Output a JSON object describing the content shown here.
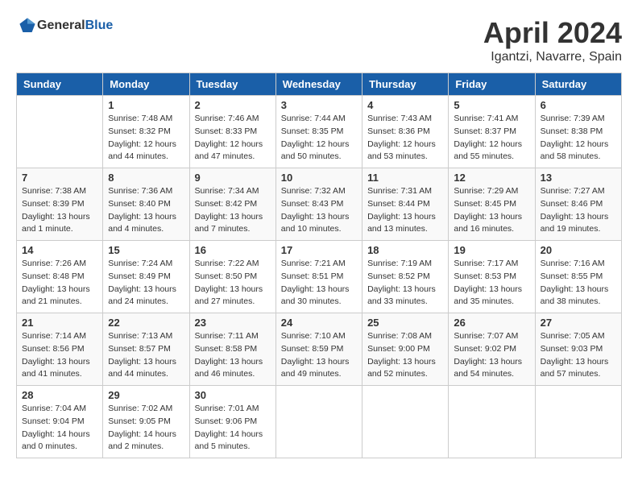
{
  "header": {
    "logo_general": "General",
    "logo_blue": "Blue",
    "month_year": "April 2024",
    "location": "Igantzi, Navarre, Spain"
  },
  "weekdays": [
    "Sunday",
    "Monday",
    "Tuesday",
    "Wednesday",
    "Thursday",
    "Friday",
    "Saturday"
  ],
  "weeks": [
    [
      {
        "day": "",
        "sunrise": "",
        "sunset": "",
        "daylight": ""
      },
      {
        "day": "1",
        "sunrise": "Sunrise: 7:48 AM",
        "sunset": "Sunset: 8:32 PM",
        "daylight": "Daylight: 12 hours and 44 minutes."
      },
      {
        "day": "2",
        "sunrise": "Sunrise: 7:46 AM",
        "sunset": "Sunset: 8:33 PM",
        "daylight": "Daylight: 12 hours and 47 minutes."
      },
      {
        "day": "3",
        "sunrise": "Sunrise: 7:44 AM",
        "sunset": "Sunset: 8:35 PM",
        "daylight": "Daylight: 12 hours and 50 minutes."
      },
      {
        "day": "4",
        "sunrise": "Sunrise: 7:43 AM",
        "sunset": "Sunset: 8:36 PM",
        "daylight": "Daylight: 12 hours and 53 minutes."
      },
      {
        "day": "5",
        "sunrise": "Sunrise: 7:41 AM",
        "sunset": "Sunset: 8:37 PM",
        "daylight": "Daylight: 12 hours and 55 minutes."
      },
      {
        "day": "6",
        "sunrise": "Sunrise: 7:39 AM",
        "sunset": "Sunset: 8:38 PM",
        "daylight": "Daylight: 12 hours and 58 minutes."
      }
    ],
    [
      {
        "day": "7",
        "sunrise": "Sunrise: 7:38 AM",
        "sunset": "Sunset: 8:39 PM",
        "daylight": "Daylight: 13 hours and 1 minute."
      },
      {
        "day": "8",
        "sunrise": "Sunrise: 7:36 AM",
        "sunset": "Sunset: 8:40 PM",
        "daylight": "Daylight: 13 hours and 4 minutes."
      },
      {
        "day": "9",
        "sunrise": "Sunrise: 7:34 AM",
        "sunset": "Sunset: 8:42 PM",
        "daylight": "Daylight: 13 hours and 7 minutes."
      },
      {
        "day": "10",
        "sunrise": "Sunrise: 7:32 AM",
        "sunset": "Sunset: 8:43 PM",
        "daylight": "Daylight: 13 hours and 10 minutes."
      },
      {
        "day": "11",
        "sunrise": "Sunrise: 7:31 AM",
        "sunset": "Sunset: 8:44 PM",
        "daylight": "Daylight: 13 hours and 13 minutes."
      },
      {
        "day": "12",
        "sunrise": "Sunrise: 7:29 AM",
        "sunset": "Sunset: 8:45 PM",
        "daylight": "Daylight: 13 hours and 16 minutes."
      },
      {
        "day": "13",
        "sunrise": "Sunrise: 7:27 AM",
        "sunset": "Sunset: 8:46 PM",
        "daylight": "Daylight: 13 hours and 19 minutes."
      }
    ],
    [
      {
        "day": "14",
        "sunrise": "Sunrise: 7:26 AM",
        "sunset": "Sunset: 8:48 PM",
        "daylight": "Daylight: 13 hours and 21 minutes."
      },
      {
        "day": "15",
        "sunrise": "Sunrise: 7:24 AM",
        "sunset": "Sunset: 8:49 PM",
        "daylight": "Daylight: 13 hours and 24 minutes."
      },
      {
        "day": "16",
        "sunrise": "Sunrise: 7:22 AM",
        "sunset": "Sunset: 8:50 PM",
        "daylight": "Daylight: 13 hours and 27 minutes."
      },
      {
        "day": "17",
        "sunrise": "Sunrise: 7:21 AM",
        "sunset": "Sunset: 8:51 PM",
        "daylight": "Daylight: 13 hours and 30 minutes."
      },
      {
        "day": "18",
        "sunrise": "Sunrise: 7:19 AM",
        "sunset": "Sunset: 8:52 PM",
        "daylight": "Daylight: 13 hours and 33 minutes."
      },
      {
        "day": "19",
        "sunrise": "Sunrise: 7:17 AM",
        "sunset": "Sunset: 8:53 PM",
        "daylight": "Daylight: 13 hours and 35 minutes."
      },
      {
        "day": "20",
        "sunrise": "Sunrise: 7:16 AM",
        "sunset": "Sunset: 8:55 PM",
        "daylight": "Daylight: 13 hours and 38 minutes."
      }
    ],
    [
      {
        "day": "21",
        "sunrise": "Sunrise: 7:14 AM",
        "sunset": "Sunset: 8:56 PM",
        "daylight": "Daylight: 13 hours and 41 minutes."
      },
      {
        "day": "22",
        "sunrise": "Sunrise: 7:13 AM",
        "sunset": "Sunset: 8:57 PM",
        "daylight": "Daylight: 13 hours and 44 minutes."
      },
      {
        "day": "23",
        "sunrise": "Sunrise: 7:11 AM",
        "sunset": "Sunset: 8:58 PM",
        "daylight": "Daylight: 13 hours and 46 minutes."
      },
      {
        "day": "24",
        "sunrise": "Sunrise: 7:10 AM",
        "sunset": "Sunset: 8:59 PM",
        "daylight": "Daylight: 13 hours and 49 minutes."
      },
      {
        "day": "25",
        "sunrise": "Sunrise: 7:08 AM",
        "sunset": "Sunset: 9:00 PM",
        "daylight": "Daylight: 13 hours and 52 minutes."
      },
      {
        "day": "26",
        "sunrise": "Sunrise: 7:07 AM",
        "sunset": "Sunset: 9:02 PM",
        "daylight": "Daylight: 13 hours and 54 minutes."
      },
      {
        "day": "27",
        "sunrise": "Sunrise: 7:05 AM",
        "sunset": "Sunset: 9:03 PM",
        "daylight": "Daylight: 13 hours and 57 minutes."
      }
    ],
    [
      {
        "day": "28",
        "sunrise": "Sunrise: 7:04 AM",
        "sunset": "Sunset: 9:04 PM",
        "daylight": "Daylight: 14 hours and 0 minutes."
      },
      {
        "day": "29",
        "sunrise": "Sunrise: 7:02 AM",
        "sunset": "Sunset: 9:05 PM",
        "daylight": "Daylight: 14 hours and 2 minutes."
      },
      {
        "day": "30",
        "sunrise": "Sunrise: 7:01 AM",
        "sunset": "Sunset: 9:06 PM",
        "daylight": "Daylight: 14 hours and 5 minutes."
      },
      {
        "day": "",
        "sunrise": "",
        "sunset": "",
        "daylight": ""
      },
      {
        "day": "",
        "sunrise": "",
        "sunset": "",
        "daylight": ""
      },
      {
        "day": "",
        "sunrise": "",
        "sunset": "",
        "daylight": ""
      },
      {
        "day": "",
        "sunrise": "",
        "sunset": "",
        "daylight": ""
      }
    ]
  ]
}
